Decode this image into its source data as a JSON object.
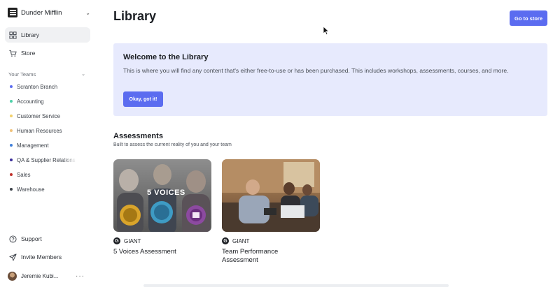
{
  "sidebar": {
    "org_name": "Dunder Mifflin",
    "nav": [
      {
        "label": "Library",
        "icon": "grid-icon",
        "active": true
      },
      {
        "label": "Store",
        "icon": "cart-icon",
        "active": false
      }
    ],
    "teams_heading": "Your Teams",
    "teams": [
      {
        "label": "Scranton Branch",
        "color": "#5b6cf0"
      },
      {
        "label": "Accounting",
        "color": "#4cd0a8"
      },
      {
        "label": "Customer Service",
        "color": "#f2d16b"
      },
      {
        "label": "Human Resources",
        "color": "#f0c27a"
      },
      {
        "label": "Management",
        "color": "#3f7fd9"
      },
      {
        "label": "QA & Supplier Relations",
        "color": "#3b2e9a"
      },
      {
        "label": "Sales",
        "color": "#c0302b"
      },
      {
        "label": "Warehouse",
        "color": "#3b4048"
      }
    ],
    "footer": [
      {
        "label": "Support",
        "icon": "help-circle-icon"
      },
      {
        "label": "Invite Members",
        "icon": "send-icon"
      }
    ],
    "user_name": "Jeremie Kubi..."
  },
  "main": {
    "title": "Library",
    "store_button": "Go to store",
    "welcome": {
      "title": "Welcome to the Library",
      "body": "This is where you will find any content that's either free-to-use or has been purchased. This includes workshops, assessments, courses, and more.",
      "button": "Okay, got it!"
    },
    "assessments": {
      "title": "Assessments",
      "subtitle": "Built to assess the current reality of you and your team",
      "cards": [
        {
          "provider": "GIANT",
          "title": "5 Voices Assessment",
          "thumb_text": "5 VOICES"
        },
        {
          "provider": "GIANT",
          "title": "Team Performance Assessment",
          "thumb_text": ""
        }
      ]
    }
  },
  "colors": {
    "accent": "#5b6cf0",
    "welcome_bg": "#e7eafd",
    "active_nav_bg": "#f0f1f3"
  }
}
